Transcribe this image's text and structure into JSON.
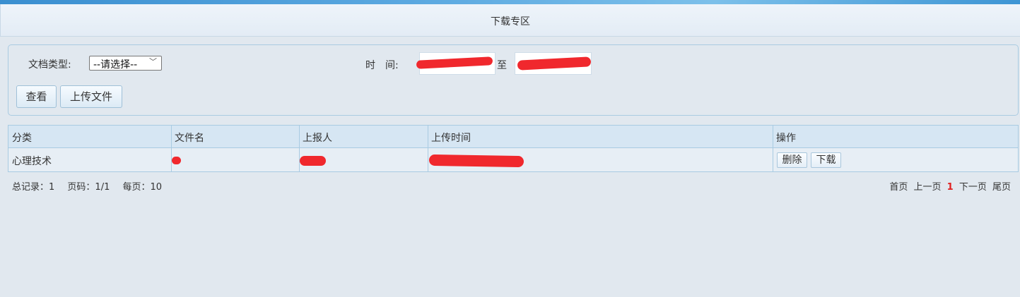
{
  "header": {
    "title": "下载专区"
  },
  "filter": {
    "doc_type_label": "文档类型:",
    "doc_type_selected": "--请选择--",
    "time_label": "时　间:",
    "to_label": "至",
    "view_button": "查看",
    "upload_button": "上传文件"
  },
  "table": {
    "columns": [
      "分类",
      "文件名",
      "上报人",
      "上传时间",
      "操作"
    ],
    "rows": [
      {
        "category": "心理技术",
        "delete_label": "删除",
        "download_label": "下载"
      }
    ]
  },
  "footer": {
    "total": "总记录：1",
    "page": "页码：1/1",
    "per_page": "每页：10"
  },
  "pager": {
    "first": "首页",
    "prev": "上一页",
    "current": "1",
    "next": "下一页",
    "last": "尾页"
  },
  "colors": {
    "accent_red": "#e02020",
    "redaction": "#f0282d",
    "border": "#a9cbe2"
  }
}
